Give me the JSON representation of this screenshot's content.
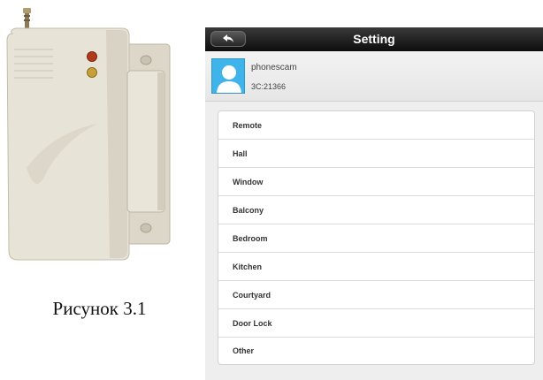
{
  "figure": {
    "caption": "Рисунок 3.1"
  },
  "app": {
    "title": "Setting",
    "account": {
      "name": "phonescam",
      "id": "3C:21366"
    },
    "zones": [
      {
        "label": "Remote"
      },
      {
        "label": "Hall"
      },
      {
        "label": "Window"
      },
      {
        "label": "Balcony"
      },
      {
        "label": "Bedroom"
      },
      {
        "label": "Kitchen"
      },
      {
        "label": "Courtyard"
      },
      {
        "label": "Door Lock"
      },
      {
        "label": "Other"
      }
    ],
    "icons": {
      "back": "back-arrow-icon",
      "avatar": "user-avatar-icon"
    },
    "colors": {
      "titlebar": "#1a1a1a",
      "avatar": "#3fb4ea",
      "background": "#eeeeee"
    }
  }
}
